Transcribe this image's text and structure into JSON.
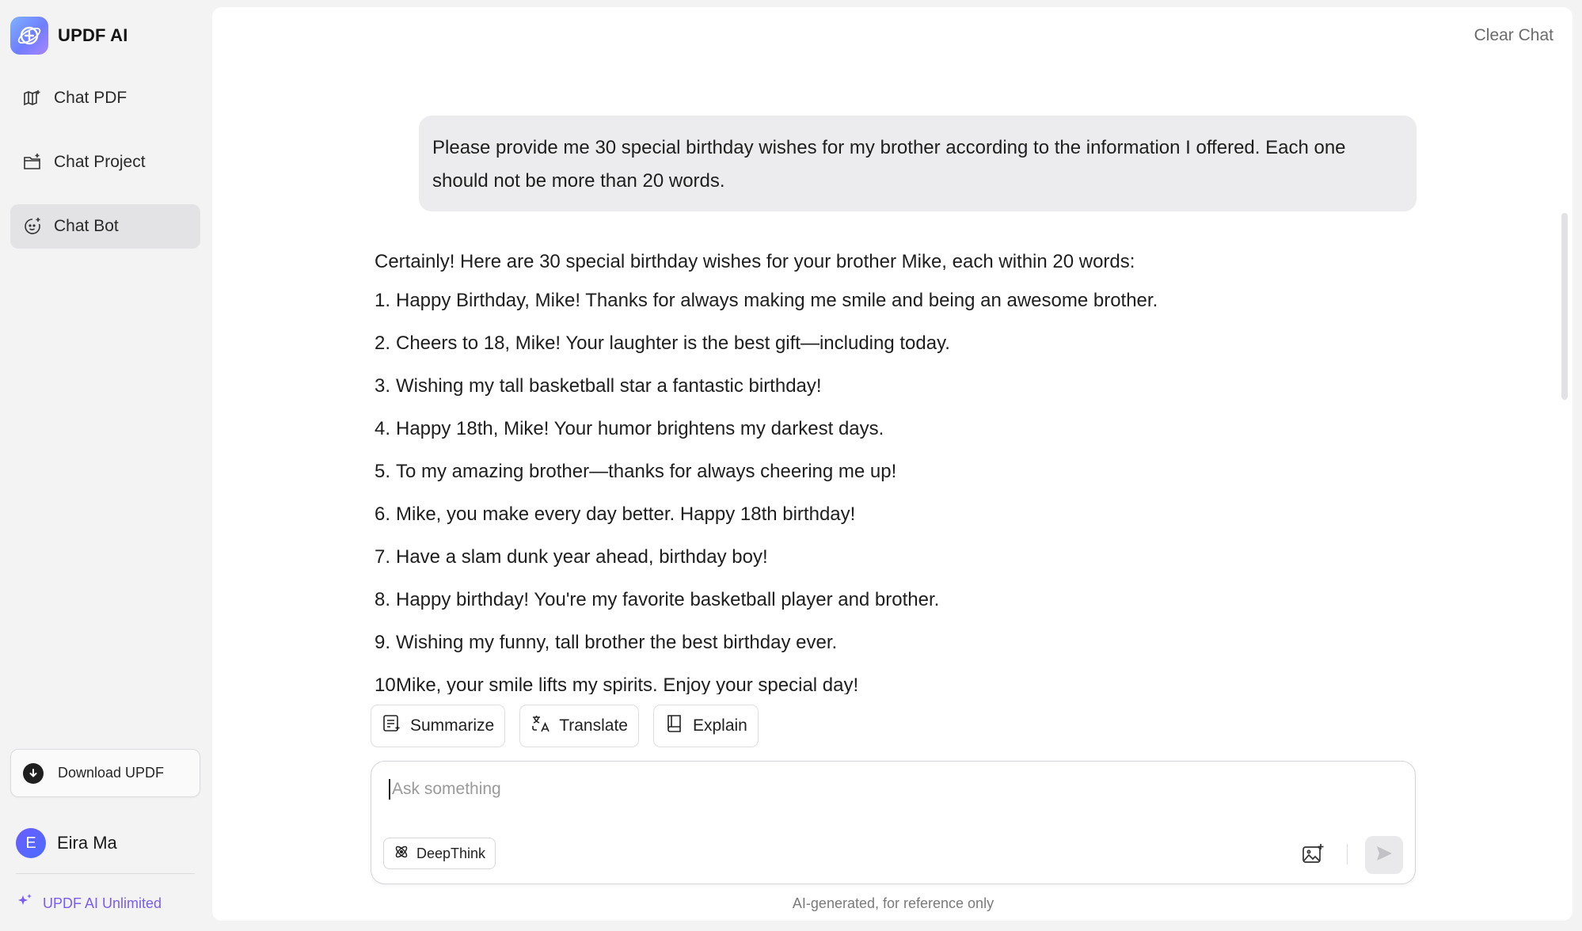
{
  "brand": {
    "name": "UPDF AI"
  },
  "sidebar": {
    "items": [
      {
        "label": "Chat PDF",
        "icon": "chat-pdf-icon",
        "active": false
      },
      {
        "label": "Chat Project",
        "icon": "chat-project-icon",
        "active": false
      },
      {
        "label": "Chat Bot",
        "icon": "chat-bot-icon",
        "active": true
      }
    ],
    "download_label": "Download UPDF",
    "user": {
      "initial": "E",
      "name": "Eira Ma"
    },
    "unlimited_label": "UPDF AI Unlimited"
  },
  "header": {
    "clear_chat": "Clear Chat"
  },
  "conversation": {
    "user_message": "Please provide me 30 special birthday wishes for my brother according to the information I offered. Each one should not be more than 20 words.",
    "answer_intro": "Certainly! Here are 30 special birthday wishes for your brother Mike, each within 20 words:",
    "items": [
      {
        "num": "1.",
        "text": "Happy Birthday, Mike! Thanks for always making me smile and being an awesome brother."
      },
      {
        "num": "2.",
        "text": "Cheers to 18, Mike! Your laughter is the best gift—including today."
      },
      {
        "num": "3.",
        "text": "Wishing my tall basketball star a fantastic birthday!"
      },
      {
        "num": "4.",
        "text": "Happy 18th, Mike! Your humor brightens my darkest days."
      },
      {
        "num": "5.",
        "text": "To my amazing brother—thanks for always cheering me up!"
      },
      {
        "num": "6.",
        "text": "Mike, you make every day better. Happy 18th birthday!"
      },
      {
        "num": "7.",
        "text": "Have a slam dunk year ahead, birthday boy!"
      },
      {
        "num": "8.",
        "text": "Happy birthday! You're my favorite basketball player and brother."
      },
      {
        "num": "9.",
        "text": "Wishing my funny, tall brother the best birthday ever."
      },
      {
        "num": "10.",
        "text": "Mike, your smile lifts my spirits. Enjoy your special day!"
      }
    ]
  },
  "quick_actions": [
    {
      "label": "Summarize",
      "icon": "summarize-icon"
    },
    {
      "label": "Translate",
      "icon": "translate-icon"
    },
    {
      "label": "Explain",
      "icon": "explain-icon"
    }
  ],
  "input": {
    "placeholder": "Ask something",
    "value": "",
    "deepthink_label": "DeepThink"
  },
  "footnote": "AI-generated, for reference only",
  "colors": {
    "accent": "#7b5cf0",
    "active_nav_bg": "#e3e3e5",
    "user_bubble_bg": "#ececee"
  }
}
